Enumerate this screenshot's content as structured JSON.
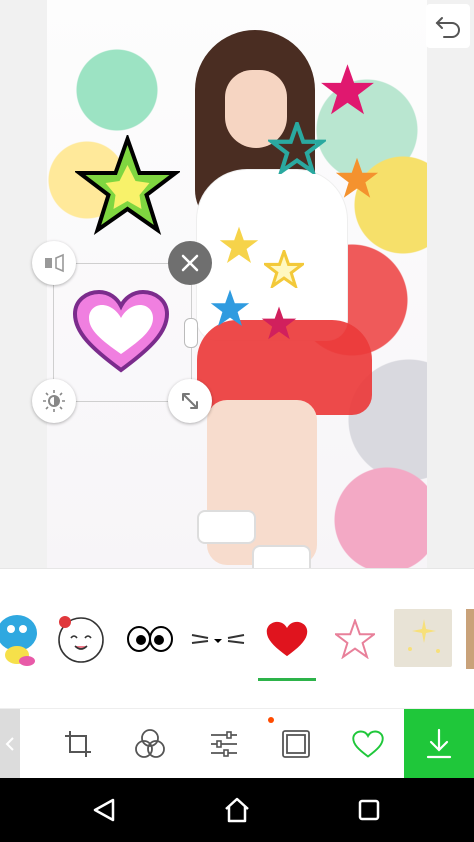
{
  "app": {
    "screen": "sticker-editor"
  },
  "colors": {
    "accent_green": "#1fc73a",
    "tab_underline": "#2db34a",
    "notification_dot": "#ff4b00",
    "nav_background": "#000000"
  },
  "canvas": {
    "stickers_on_photo": [
      {
        "name": "green-yellow-star",
        "color": "#8fe04a"
      },
      {
        "name": "pink-heart",
        "color": "#f07fe0"
      },
      {
        "name": "magenta-star",
        "color": "#e0186f"
      },
      {
        "name": "teal-star",
        "color": "#2aa9a0"
      },
      {
        "name": "orange-star",
        "color": "#f4922e"
      },
      {
        "name": "yellow-star",
        "color": "#f6d34a"
      },
      {
        "name": "blue-star",
        "color": "#2f9be0"
      }
    ],
    "controls": {
      "close_icon": "close-icon",
      "resize_icon": "resize-arrows-icon",
      "flip_icon": "flip-icon",
      "brightness_icon": "brightness-icon"
    }
  },
  "sticker_tray": {
    "items": [
      {
        "name": "blue-character-sticker"
      },
      {
        "name": "flower-character-sticker"
      },
      {
        "name": "eyes-sticker"
      },
      {
        "name": "whiskers-sticker"
      },
      {
        "name": "red-heart-sticker",
        "selected": true
      },
      {
        "name": "pink-star-outline-sticker"
      },
      {
        "name": "sparkle-sticker"
      }
    ]
  },
  "toolbar": {
    "items": [
      {
        "name": "crop-tool",
        "icon": "crop-icon"
      },
      {
        "name": "filter-tool",
        "icon": "filters-icon"
      },
      {
        "name": "adjust-tool",
        "icon": "sliders-icon"
      },
      {
        "name": "frame-tool",
        "icon": "frame-icon"
      },
      {
        "name": "sticker-tool",
        "icon": "heart-outline-icon",
        "active": true
      },
      {
        "name": "download-button",
        "icon": "download-icon"
      }
    ]
  },
  "system_nav": {
    "buttons": [
      "back",
      "home",
      "recents"
    ]
  }
}
